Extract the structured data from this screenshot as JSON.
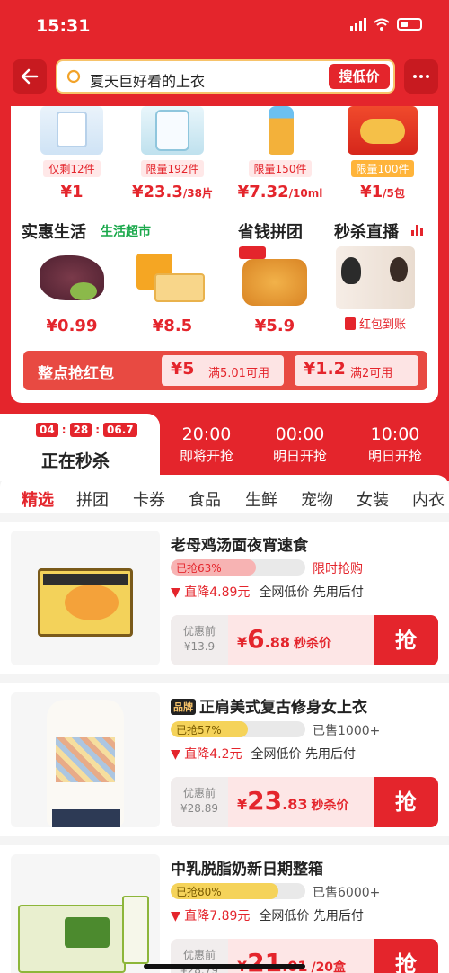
{
  "status": {
    "time": "15:31"
  },
  "search": {
    "query": "夏天巨好看的上衣",
    "button": "搜低价"
  },
  "top_products": [
    {
      "badge": "仅剩12件",
      "price": "¥1",
      "unit": ""
    },
    {
      "badge": "限量192件",
      "price": "¥23.3",
      "unit": "/38片"
    },
    {
      "badge": "限量150件",
      "price": "¥7.32",
      "unit": "/10ml"
    },
    {
      "badge": "限量100件",
      "price": "¥1",
      "unit": "/5包"
    }
  ],
  "sections": {
    "benefit": {
      "title": "实惠生活",
      "tag": "生活超市"
    },
    "group": {
      "title": "省钱拼团"
    },
    "live": {
      "title": "秒杀直播",
      "badge": "红包到账"
    }
  },
  "mid_products": [
    {
      "price": "¥0.99"
    },
    {
      "price": "¥8.5"
    },
    {
      "price": "¥5.9"
    }
  ],
  "hongbao": {
    "title": "整点抢红包",
    "coupons": [
      {
        "amount": "¥5",
        "cond": "满5.01可用"
      },
      {
        "amount": "¥1.2",
        "cond": "满2可用"
      }
    ]
  },
  "flash": {
    "timer": [
      "04",
      "28",
      "06.7"
    ],
    "active_label": "正在秒杀",
    "slots": [
      {
        "time": "20:00",
        "label": "即将开抢"
      },
      {
        "time": "00:00",
        "label": "明日开抢"
      },
      {
        "time": "10:00",
        "label": "明日开抢"
      }
    ]
  },
  "categories": [
    "精选",
    "拼团",
    "卡券",
    "食品",
    "生鲜",
    "宠物",
    "女装",
    "内衣"
  ],
  "items": [
    {
      "title": "老母鸡汤面夜宵速食",
      "brand": "",
      "progress_text": "已抢63%",
      "progress": 0.63,
      "sold": "限时抢购",
      "drop": "直降4.89元",
      "tags": "全网低价  先用后付",
      "orig_label": "优惠前",
      "orig_price": "¥13.9",
      "sale_yen": "¥",
      "sale_int": "6",
      "sale_dec": ".88",
      "sale_label": "秒杀价",
      "grab": "抢"
    },
    {
      "title": "正肩美式复古修身女上衣",
      "brand": "品牌",
      "progress_text": "已抢57%",
      "progress": 0.57,
      "sold": "已售1000+",
      "drop": "直降4.2元",
      "tags": "全网低价  先用后付",
      "orig_label": "优惠前",
      "orig_price": "¥28.89",
      "sale_yen": "¥",
      "sale_int": "23",
      "sale_dec": ".83",
      "sale_label": "秒杀价",
      "grab": "抢"
    },
    {
      "title": "中乳脱脂奶新日期整箱",
      "brand": "",
      "progress_text": "已抢80%",
      "progress": 0.8,
      "sold": "已售6000+",
      "drop": "直降7.89元",
      "tags": "全网低价  先用后付",
      "orig_label": "优惠前",
      "orig_price": "¥28.79",
      "sale_yen": "¥",
      "sale_int": "21",
      "sale_dec": ".01",
      "sale_label": "/20盒",
      "grab": "抢"
    }
  ],
  "colors": {
    "accent": "#e4252c",
    "progress_red": "#f7b3b3",
    "progress_yellow": "#f5d35a",
    "coupon_bg": "#fde4e4"
  }
}
